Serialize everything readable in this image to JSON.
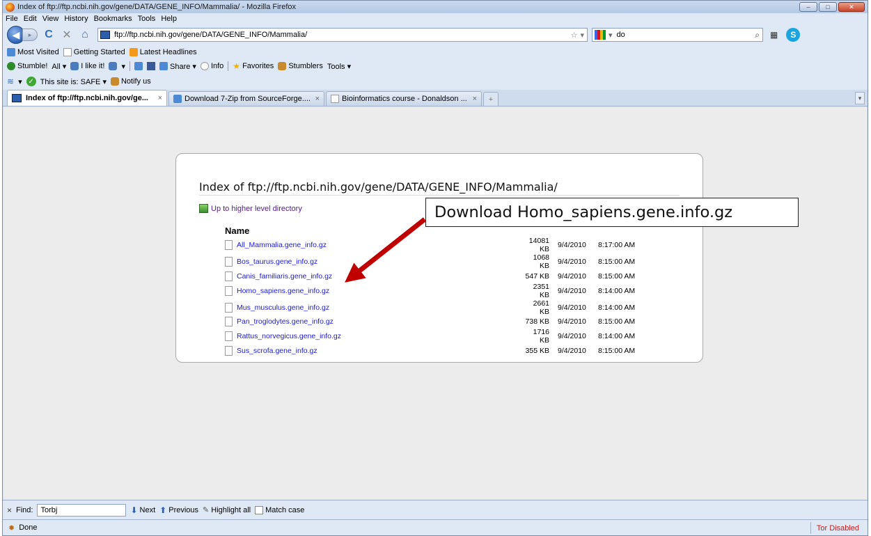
{
  "window": {
    "title": "Index of ftp://ftp.ncbi.nih.gov/gene/DATA/GENE_INFO/Mammalia/ - Mozilla Firefox",
    "minimize_glyph": "–",
    "maximize_glyph": "□",
    "close_glyph": "✕"
  },
  "menubar": {
    "items": [
      "File",
      "Edit",
      "View",
      "History",
      "Bookmarks",
      "Tools",
      "Help"
    ]
  },
  "navbar": {
    "back_glyph": "◀",
    "fwd_glyph": "▸",
    "reload_glyph": "C",
    "stop_glyph": "✕",
    "home_glyph": "⌂",
    "url": "ftp://ftp.ncbi.nih.gov/gene/DATA/GENE_INFO/Mammalia/",
    "url_star": "☆",
    "url_drop": "▾",
    "search_value": "do",
    "search_engine_drop": "▾",
    "search_go_glyph": "⌕",
    "grid_glyph": "▦",
    "skype_glyph": "S"
  },
  "bookmarks": {
    "items": [
      "Most Visited",
      "Getting Started",
      "Latest Headlines"
    ]
  },
  "stumble": {
    "stumble": "Stumble!",
    "all": "All ▾",
    "ilike": "I like it!",
    "thumb_drop": "▾",
    "share": "Share ▾",
    "info": "Info",
    "favorites": "Favorites",
    "stumblers": "Stumblers",
    "tools": "Tools ▾"
  },
  "safebar": {
    "wifi_drop": "▾",
    "safe_text": "This site is: SAFE ▾",
    "notify": "Notify us"
  },
  "tabs": [
    {
      "label": "Index of ftp://ftp.ncbi.nih.gov/ge...",
      "close": "×"
    },
    {
      "label": "Download 7-Zip from SourceForge....",
      "close": "×"
    },
    {
      "label": "Bioinformatics course - Donaldson ...",
      "close": "×"
    }
  ],
  "tab_new": "+",
  "tab_list": "▾",
  "page": {
    "title": "Index of ftp://ftp.ncbi.nih.gov/gene/DATA/GENE_INFO/Mammalia/",
    "up_link": "Up to higher level directory",
    "name_header": "Name",
    "files": [
      {
        "name": "All_Mammalia.gene_info.gz",
        "size": "14081 KB",
        "date": "9/4/2010",
        "time": "8:17:00 AM"
      },
      {
        "name": "Bos_taurus.gene_info.gz",
        "size": "1068 KB",
        "date": "9/4/2010",
        "time": "8:15:00 AM"
      },
      {
        "name": "Canis_familiaris.gene_info.gz",
        "size": "547 KB",
        "date": "9/4/2010",
        "time": "8:15:00 AM"
      },
      {
        "name": "Homo_sapiens.gene_info.gz",
        "size": "2351 KB",
        "date": "9/4/2010",
        "time": "8:14:00 AM"
      },
      {
        "name": "Mus_musculus.gene_info.gz",
        "size": "2661 KB",
        "date": "9/4/2010",
        "time": "8:14:00 AM"
      },
      {
        "name": "Pan_troglodytes.gene_info.gz",
        "size": "738 KB",
        "date": "9/4/2010",
        "time": "8:15:00 AM"
      },
      {
        "name": "Rattus_norvegicus.gene_info.gz",
        "size": "1716 KB",
        "date": "9/4/2010",
        "time": "8:14:00 AM"
      },
      {
        "name": "Sus_scrofa.gene_info.gz",
        "size": "355 KB",
        "date": "9/4/2010",
        "time": "8:15:00 AM"
      }
    ]
  },
  "annotation": {
    "text": "Download Homo_sapiens.gene.info.gz",
    "arrow_color": "#c00000"
  },
  "findbar": {
    "close_glyph": "×",
    "label": "Find:",
    "value": "Torbj",
    "next": "Next",
    "next_glyph": "⬇",
    "previous": "Previous",
    "previous_glyph": "⬆",
    "highlight_glyph": "✎",
    "highlight": "Highlight all",
    "match_case": "Match case"
  },
  "status": {
    "icon_glyph": "✹",
    "text": "Done",
    "tor": "Tor Disabled"
  }
}
